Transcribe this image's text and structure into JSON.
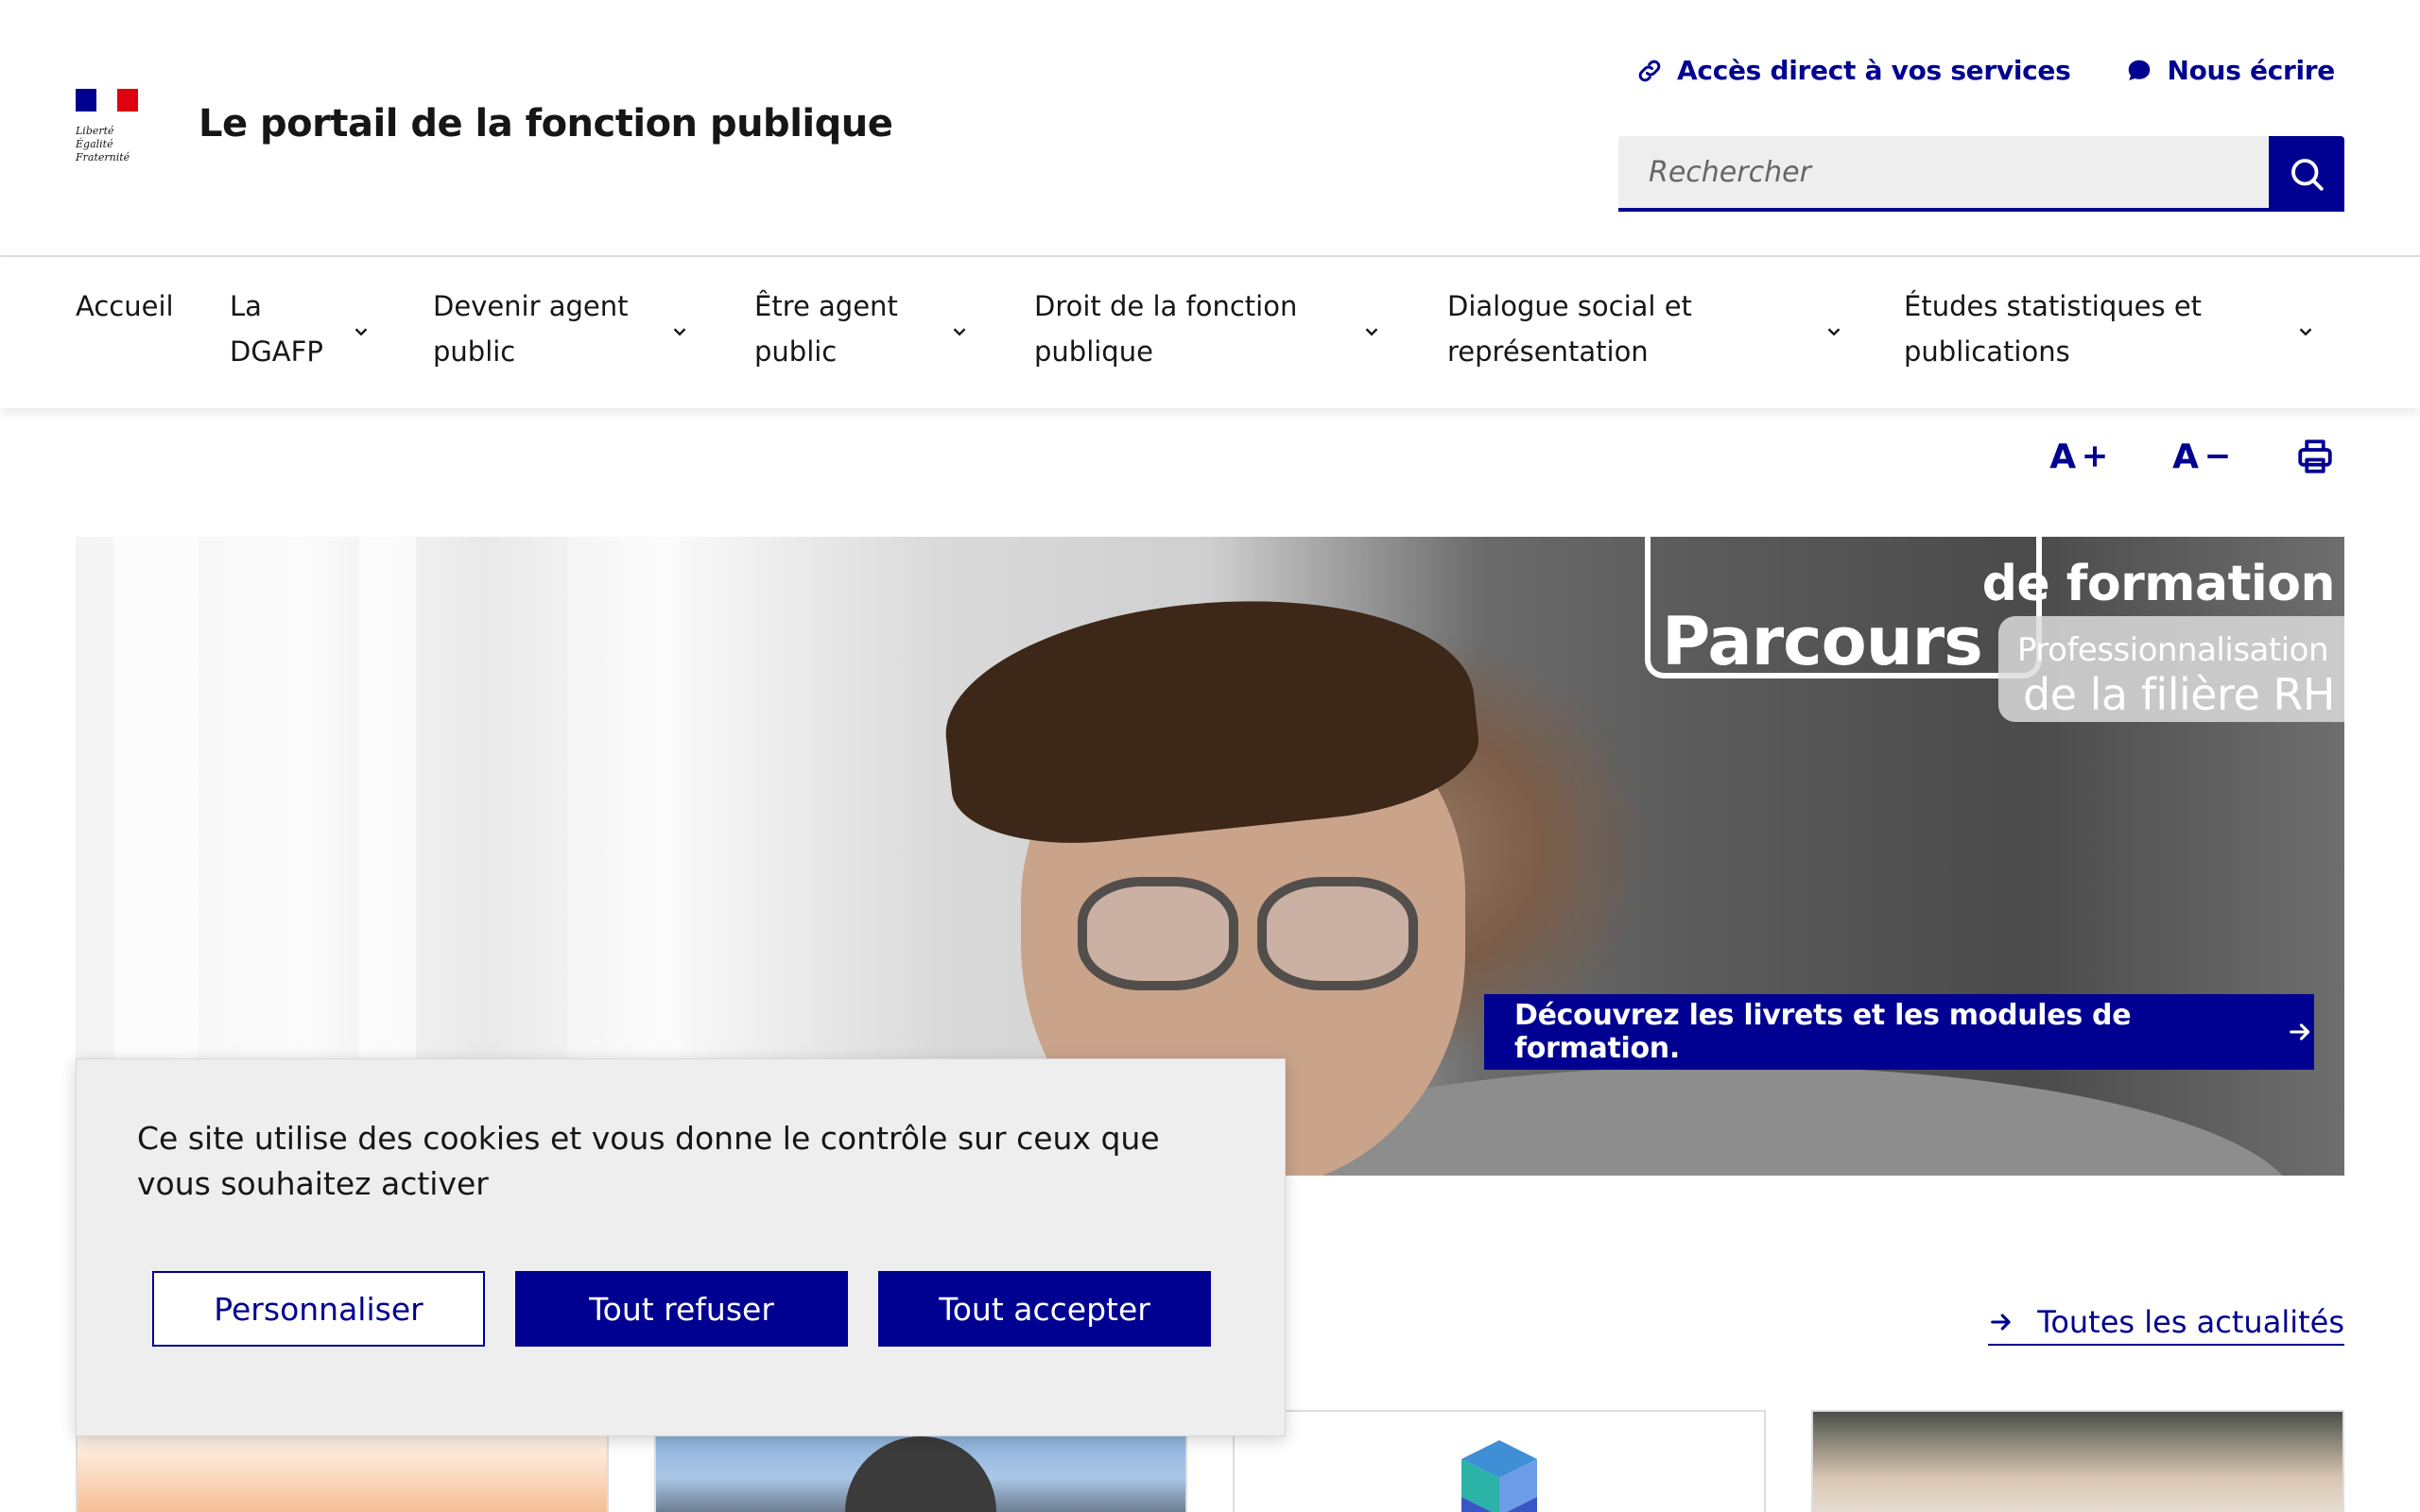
{
  "header": {
    "logo_motto": [
      "Liberté",
      "Égalité",
      "Fraternité"
    ],
    "site_title": "Le portail de la fonction publique",
    "tool_links": [
      {
        "label": "Accès direct à vos services",
        "icon": "link-icon"
      },
      {
        "label": "Nous écrire",
        "icon": "chat-bubble-icon"
      }
    ],
    "search": {
      "placeholder": "Rechercher",
      "button_icon": "search-icon"
    }
  },
  "nav": {
    "items": [
      {
        "line1": "Accueil",
        "line2": "",
        "has_submenu": false
      },
      {
        "line1": "La",
        "line2": "DGAFP",
        "has_submenu": true
      },
      {
        "line1": "Devenir agent",
        "line2": "public",
        "has_submenu": true
      },
      {
        "line1": "Être agent",
        "line2": "public",
        "has_submenu": true
      },
      {
        "line1": "Droit de la fonction",
        "line2": "publique",
        "has_submenu": true
      },
      {
        "line1": "Dialogue social et",
        "line2": "représentation",
        "has_submenu": true
      },
      {
        "line1": "Études statistiques et",
        "line2": "publications",
        "has_submenu": true
      }
    ]
  },
  "text_tools": {
    "increase": "A",
    "decrease": "A",
    "print_icon": "printer-icon"
  },
  "hero": {
    "overlay_parcours": "Parcours",
    "overlay_de_formation": "de formation",
    "overlay_pro_line1": "Professionnalisation",
    "overlay_pro_line2": "de la filière RH",
    "cta_label": "Découvrez les livrets et les modules de formation."
  },
  "news": {
    "all_link": "Toutes les actualités"
  },
  "cookie_banner": {
    "text": "Ce site utilise des cookies et vous donne le contrôle sur ceux que vous souhaitez activer",
    "personalize": "Personnaliser",
    "refuse": "Tout refuser",
    "accept": "Tout accepter"
  },
  "colors": {
    "primary": "#000091",
    "flag_red": "#e1000f",
    "banner_bg": "#eeeeee",
    "search_bg": "#eeeeee"
  }
}
